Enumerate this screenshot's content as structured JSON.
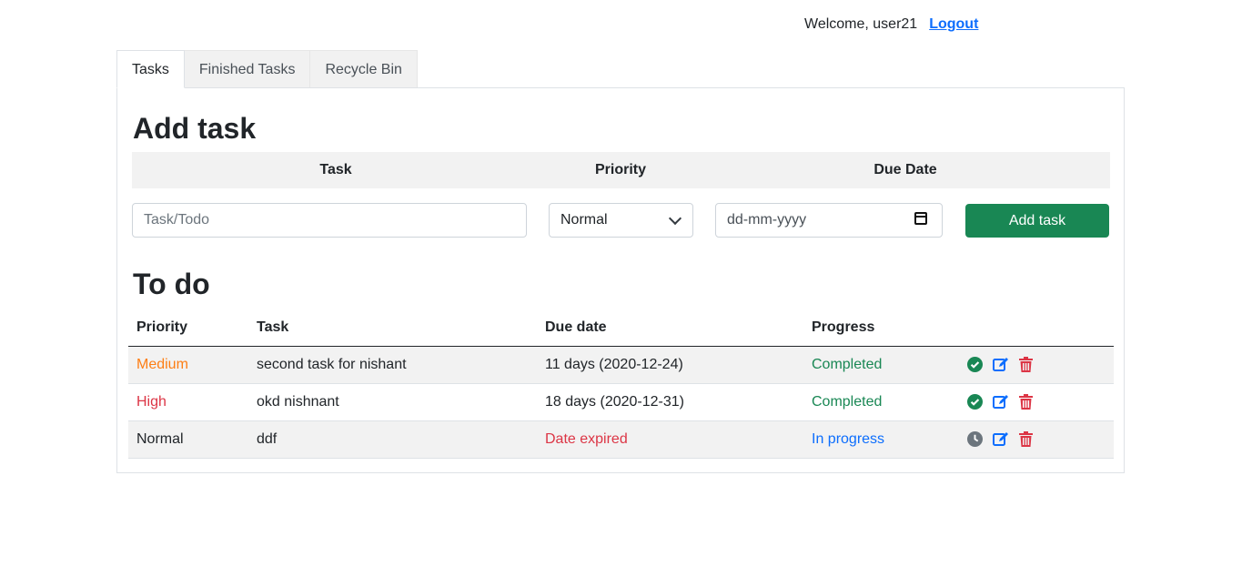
{
  "header": {
    "welcome": "Welcome, user21",
    "logout": "Logout"
  },
  "tabs": [
    {
      "label": "Tasks",
      "active": true
    },
    {
      "label": "Finished Tasks",
      "active": false
    },
    {
      "label": "Recycle Bin",
      "active": false
    }
  ],
  "add_task": {
    "title": "Add task",
    "columns": {
      "task": "Task",
      "priority": "Priority",
      "due_date": "Due Date"
    },
    "task_placeholder": "Task/Todo",
    "task_value": "",
    "priority_selected": "Normal",
    "date_placeholder": "dd-mm-yyyy",
    "button": "Add task"
  },
  "todo": {
    "title": "To do",
    "columns": {
      "priority": "Priority",
      "task": "Task",
      "due": "Due date",
      "progress": "Progress"
    },
    "rows": [
      {
        "priority": "Medium",
        "task": "second task for nishant",
        "due": "11 days (2020-12-24)",
        "progress": "Completed",
        "status_icon": "check-circle-icon"
      },
      {
        "priority": "High",
        "task": "okd nishnant",
        "due": "18 days (2020-12-31)",
        "progress": "Completed",
        "status_icon": "check-circle-icon"
      },
      {
        "priority": "Normal",
        "task": "ddf",
        "due": "Date expired",
        "progress": "In progress",
        "status_icon": "clock-icon"
      }
    ]
  },
  "colors": {
    "medium": "#fd7e14",
    "high": "#dc3545",
    "normal": "#212529",
    "completed": "#198754",
    "in_progress": "#0d6efd",
    "expired": "#dc3545",
    "edit": "#0d6efd",
    "delete": "#dc3545",
    "clock": "#6c757d",
    "button": "#198754"
  }
}
